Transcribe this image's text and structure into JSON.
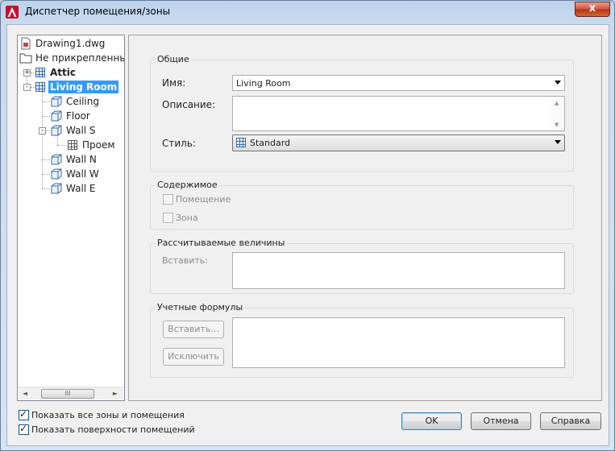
{
  "window": {
    "title": "Диспетчер помещения/зоны",
    "close_label": "x"
  },
  "tree": {
    "items": [
      {
        "label": "Drawing1.dwg",
        "icon": "drawing-file-icon"
      },
      {
        "label": "Не прикрепленные",
        "icon": "folder-icon"
      },
      {
        "label": "Attic",
        "icon": "zone-icon",
        "expander": "+"
      },
      {
        "label": "Living Room",
        "icon": "zone-icon",
        "expander": "-",
        "selected": true
      },
      {
        "label": "Ceiling",
        "icon": "surface-icon"
      },
      {
        "label": "Floor",
        "icon": "surface-icon"
      },
      {
        "label": "Wall S",
        "icon": "surface-icon",
        "expander": "-"
      },
      {
        "label": "Проем",
        "icon": "opening-icon"
      },
      {
        "label": "Wall N",
        "icon": "surface-icon"
      },
      {
        "label": "Wall W",
        "icon": "surface-icon"
      },
      {
        "label": "Wall E",
        "icon": "surface-icon"
      }
    ],
    "scroll_arrow_left": "◄",
    "scroll_arrow_right": "►",
    "scroll_thumb": "III"
  },
  "general": {
    "title": "Общие",
    "name_label": "Имя:",
    "name_value": "Living Room",
    "description_label": "Описание:",
    "description_value": "",
    "style_label": "Стиль:",
    "style_value": "Standard"
  },
  "contents": {
    "title": "Содержимое",
    "room_label": "Помещение",
    "room_checked": false,
    "zone_label": "Зона",
    "zone_checked": false
  },
  "calculated": {
    "title": "Рассчитываемые величины",
    "insert_label": "Вставить:"
  },
  "formulas": {
    "title": "Учетные формулы",
    "insert_button": "Вставить...",
    "exclude_button": "Исключить"
  },
  "footer": {
    "show_all_label": "Показать все зоны и помещения",
    "show_all_checked": true,
    "show_surfaces_label": "Показать поверхности помещений",
    "show_surfaces_checked": true,
    "ok_button": "OK",
    "cancel_button": "Отмена",
    "help_button": "Справка"
  }
}
